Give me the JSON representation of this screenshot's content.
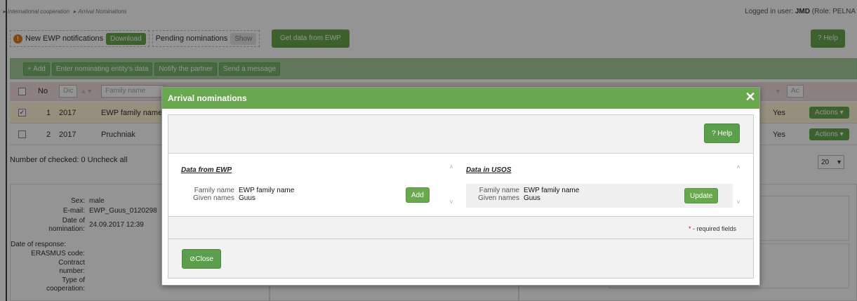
{
  "breadcrumb": [
    "International cooperation",
    "Arrival Nominations"
  ],
  "login": {
    "prefix": "Logged in user:",
    "user": "JMD",
    "role": "(Role: PELNA"
  },
  "notif": {
    "new_label": "New EWP notifications",
    "download": "Download",
    "pending_label": "Pending nominations",
    "show": "Show",
    "get_data": "Get data from EWP",
    "help": "? Help"
  },
  "actions": [
    "+ Add",
    "Enter nominating entity's data",
    "Notify the partner",
    "Send a message"
  ],
  "table": {
    "header": {
      "no": "No",
      "dic": "Dic",
      "family": "Family name",
      "ac": "Ac"
    },
    "rows": [
      {
        "checked": true,
        "no": "1",
        "year": "2017",
        "family": "EWP family name",
        "yes": "Yes",
        "actions": "Actions"
      },
      {
        "checked": false,
        "no": "2",
        "year": "2017",
        "family": "Pruchniak",
        "yes": "Yes",
        "actions": "Actions"
      }
    ],
    "count": "Number of checked: 0 Uncheck all",
    "page_size": "20"
  },
  "details": {
    "sex_label": "Sex:",
    "sex": "male",
    "email_label": "E-mail:",
    "email": "EWP_Guus_0120298",
    "date_nom_label1": "Date of",
    "date_nom_label2": "nomination:",
    "date_nom": "24.09.2017 12:39",
    "date_resp_label": "Date of response:",
    "erasmus_label": "ERASMUS code:",
    "contract_label1": "Contract",
    "contract_label2": "number:",
    "type_label1": "Type of",
    "type_label2": "cooperation:"
  },
  "modal": {
    "title": "Arrival nominations",
    "help": "? Help",
    "left_title": "Data from EWP",
    "right_title": "Data in USOS",
    "family_label": "Family name",
    "given_label": "Given names",
    "ewp_family": "EWP family name",
    "ewp_given": "Guus",
    "usos_family": "EWP family name",
    "usos_given": "Guus",
    "add": "Add",
    "update": "Update",
    "required": "- required fields",
    "required_star": "*",
    "close": "Close"
  }
}
